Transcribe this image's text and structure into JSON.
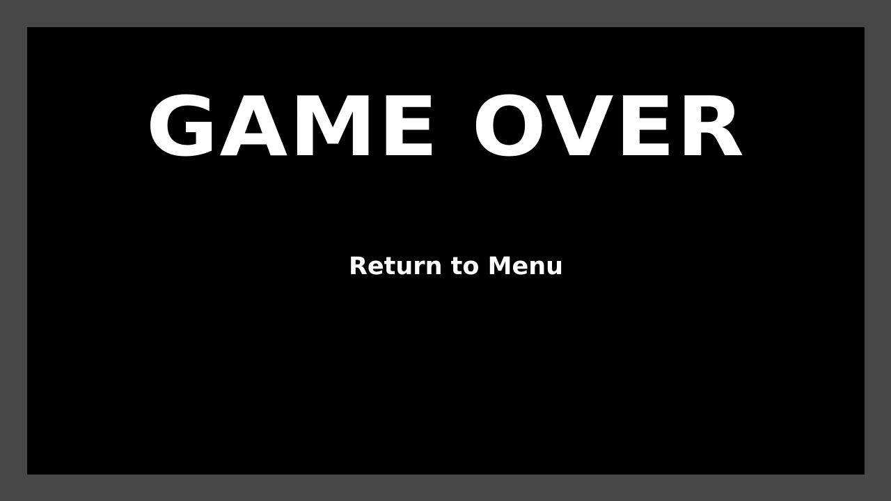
{
  "screen": {
    "title": "GAME OVER",
    "menu": {
      "return_label": "Return to Menu"
    }
  },
  "colors": {
    "border": "#474747",
    "background": "#000000",
    "text": "#ffffff"
  }
}
